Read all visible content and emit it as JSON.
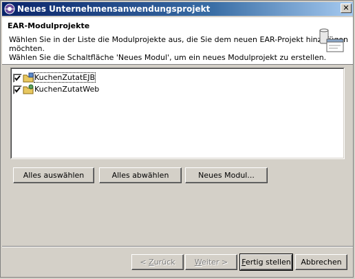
{
  "window": {
    "title": "Neues Unternehmensanwendungsprojekt",
    "close_label": "✕"
  },
  "banner": {
    "title": "EAR-Modulprojekte",
    "description_lines": [
      "Wählen Sie in der Liste die Modulprojekte aus, die Sie dem neuen EAR-Projekt hinzufügen",
      "möchten.",
      "Wählen Sie die Schaltfläche 'Neues Modul', um ein neues Modulprojekt zu erstellen."
    ]
  },
  "modules": [
    {
      "label": "KuchenZutatEJB",
      "checked": true,
      "icon": "ejb-project-icon"
    },
    {
      "label": "KuchenZutatWeb",
      "checked": true,
      "icon": "web-project-icon"
    }
  ],
  "list_buttons": {
    "select_all": "Alles auswählen",
    "deselect_all": "Alles abwählen",
    "new_module": "Neues Modul..."
  },
  "wizard_buttons": {
    "back_mnemonic": "Z",
    "back_rest": "urück",
    "back_prefix": "< ",
    "next_mnemonic": "W",
    "next_rest": "eiter >",
    "finish_mnemonic": "F",
    "finish_rest": "ertig stellen",
    "cancel": "Abbrechen"
  },
  "colors": {
    "titlebar_start": "#0a246a",
    "titlebar_end": "#a6caf0",
    "face": "#d4d0c8"
  }
}
